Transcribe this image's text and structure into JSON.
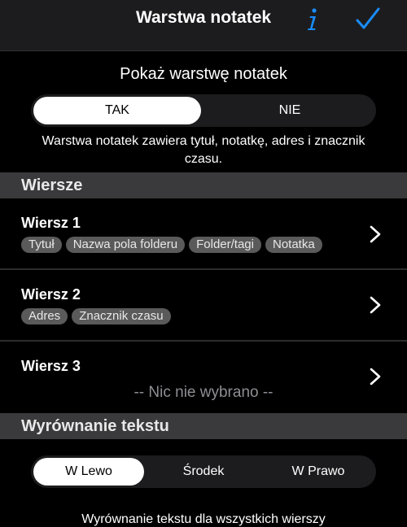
{
  "nav": {
    "title": "Warstwa notatek"
  },
  "overlay": {
    "heading": "Pokaż warstwę notatek",
    "options": [
      "TAK",
      "NIE"
    ],
    "description": "Warstwa notatek zawiera tytuł, notatkę, adres i znacznik czasu."
  },
  "rows_section": {
    "title": "Wiersze"
  },
  "rows": [
    {
      "title": "Wiersz 1",
      "chips": [
        "Tytuł",
        "Nazwa pola folderu",
        "Folder/tagi",
        "Notatka"
      ]
    },
    {
      "title": "Wiersz 2",
      "chips": [
        "Adres",
        "Znacznik czasu"
      ]
    },
    {
      "title": "Wiersz 3",
      "empty": "-- Nic nie wybrano --"
    }
  ],
  "alignment": {
    "title": "Wyrównanie tekstu",
    "options": [
      "W Lewo",
      "Środek",
      "W Prawo"
    ],
    "footer": "Wyrównanie tekstu dla wszystkich wierszy"
  },
  "colors": {
    "accent": "#1a8cff",
    "background": "#000000",
    "band": "#3a3a3c",
    "chip": "#5a5a5a"
  }
}
